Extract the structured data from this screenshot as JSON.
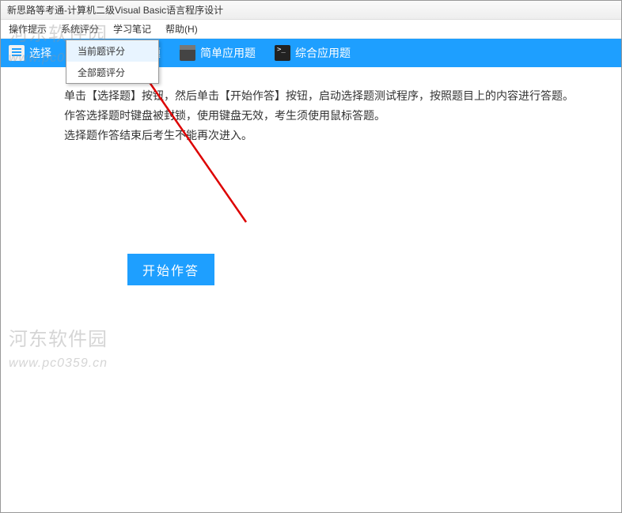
{
  "window": {
    "title": "新思路等考通-计算机二级Visual Basic语言程序设计"
  },
  "menubar": {
    "items": [
      "操作提示",
      "系统评分",
      "学习笔记",
      "帮助(H)"
    ]
  },
  "dropdown": {
    "items": [
      "当前题评分",
      "全部题评分"
    ]
  },
  "tabs": [
    {
      "label": "选择",
      "icon": "list-icon"
    },
    {
      "label": "作题",
      "icon": "doc-icon"
    },
    {
      "label": "简单应用题",
      "icon": "app-icon"
    },
    {
      "label": "综合应用题",
      "icon": "cmd-icon"
    }
  ],
  "content": {
    "p1": "单击【选择题】按钮，然后单击【开始作答】按钮，启动选择题测试程序，按照题目上的内容进行答题。",
    "p2": "作答选择题时键盘被封锁，使用键盘无效，考生须使用鼠标答题。",
    "p3": "选择题作答结束后考生不能再次进入。"
  },
  "actions": {
    "start_label": "开始作答"
  },
  "watermark": {
    "site_cn": "河东软件园",
    "site_url": "www.pc0359.cn"
  }
}
